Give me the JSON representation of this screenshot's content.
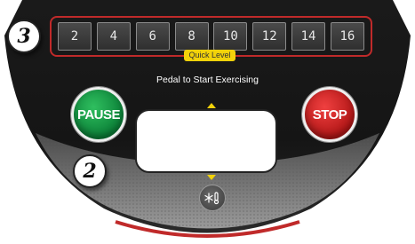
{
  "console": {
    "instruction": "Pedal to Start Exercising",
    "quick_level": {
      "label": "Quick Level",
      "levels": [
        "2",
        "4",
        "6",
        "8",
        "10",
        "12",
        "14",
        "16"
      ]
    },
    "buttons": {
      "pause": "PAUSE",
      "stop": "STOP"
    },
    "callouts": {
      "top_left": "3",
      "bottom_left": "2"
    },
    "colors": {
      "console_body": "#141414",
      "accent_red": "#c02a2a",
      "quick_level_label": "#f2d20a",
      "pause_green": "#0b7f37",
      "stop_red": "#b11616"
    },
    "icons": {
      "fan": "fan-icon"
    }
  }
}
